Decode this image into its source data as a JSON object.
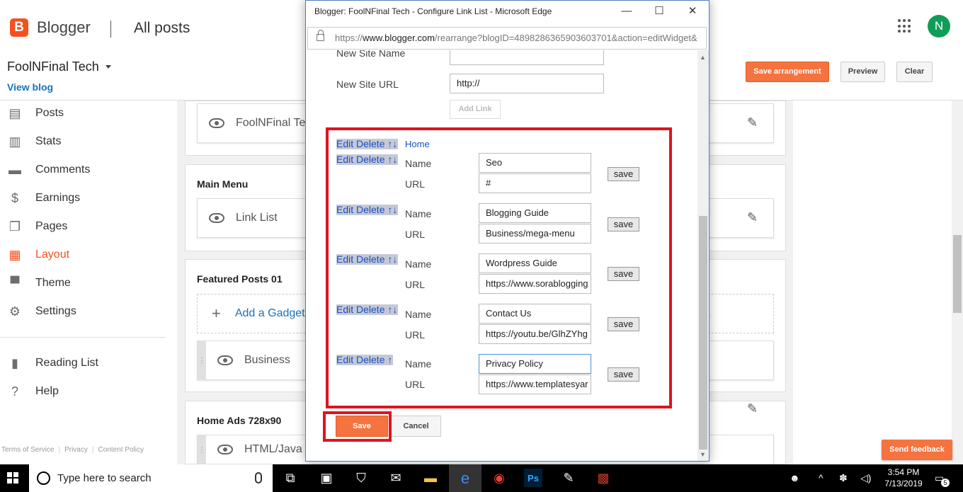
{
  "app": {
    "logo_letter": "B",
    "name": "Blogger",
    "page_heading": "All posts",
    "avatar_letter": "N"
  },
  "blog": {
    "name": "FoolNFinal Tech",
    "view_blog": "View blog"
  },
  "header_buttons": {
    "save_arrangement": "Save arrangement",
    "preview": "Preview",
    "clear": "Clear"
  },
  "sidebar": {
    "items": [
      {
        "label": "Posts",
        "icon": "posts-icon"
      },
      {
        "label": "Stats",
        "icon": "stats-icon"
      },
      {
        "label": "Comments",
        "icon": "comments-icon"
      },
      {
        "label": "Earnings",
        "icon": "earnings-icon"
      },
      {
        "label": "Pages",
        "icon": "pages-icon"
      },
      {
        "label": "Layout",
        "icon": "layout-icon",
        "active": true
      },
      {
        "label": "Theme",
        "icon": "theme-icon"
      },
      {
        "label": "Settings",
        "icon": "settings-icon"
      }
    ],
    "secondary": [
      {
        "label": "Reading List",
        "icon": "bookmark-icon"
      },
      {
        "label": "Help",
        "icon": "help-icon"
      }
    ],
    "footer": [
      "Terms of Service",
      "Privacy",
      "Content Policy"
    ]
  },
  "canvas": {
    "gadget_top": "FoolNFinal Te",
    "main_menu_title": "Main Menu",
    "main_menu_gadget": "Link List",
    "featured_title": "Featured Posts 01",
    "add_gadget": "Add a Gadget",
    "add_gadget_right_frag": "t",
    "business_gadget": "Business",
    "home_ads_title": "Home Ads 728x90",
    "home_ads_gadget": "HTML/Java"
  },
  "feedback": "Send feedback",
  "popup": {
    "title": "Blogger: FoolNFinal Tech - Configure Link List - Microsoft Edge",
    "url_prefix": "https://",
    "url_domain": "www.blogger.com",
    "url_rest": "/rearrange?blogID=4898286365903603701&action=editWidget&",
    "new_site_name_label": "New Site Name",
    "new_site_url_label": "New Site URL",
    "new_site_url_value": "http://",
    "add_link": "Add Link",
    "controls": {
      "edit": "Edit",
      "delete": "Delete",
      "up": "↑",
      "down": "↓"
    },
    "home_link": "Home",
    "name_label": "Name",
    "url_label": "URL",
    "save_small": "save",
    "links": [
      {
        "name": "Seo",
        "url": "#"
      },
      {
        "name": "Blogging Guide",
        "url": "Business/mega-menu"
      },
      {
        "name": "Wordpress Guide",
        "url": "https://www.sorablogging"
      },
      {
        "name": "Contact Us",
        "url": "https://youtu.be/GlhZYhg"
      },
      {
        "name": "Privacy Policy",
        "url": "https://www.templatesyar"
      }
    ],
    "save": "Save",
    "cancel": "Cancel"
  },
  "taskbar": {
    "search_placeholder": "Type here to search",
    "time": "3:54 PM",
    "date": "7/13/2019",
    "notification_count": "5"
  }
}
